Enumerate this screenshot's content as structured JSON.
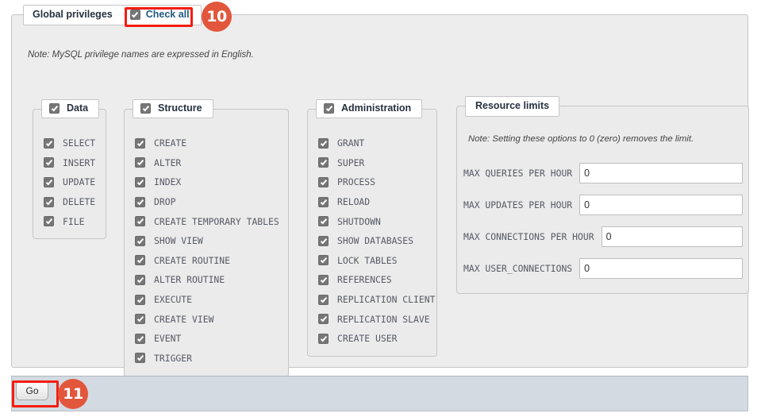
{
  "panel": {
    "legend_title": "Global privileges",
    "check_all_label": "Check all",
    "note": "Note: MySQL privilege names are expressed in English."
  },
  "annotations": [
    {
      "number": "10",
      "target": "check-all"
    },
    {
      "number": "11",
      "target": "go-button"
    }
  ],
  "groups": {
    "data": {
      "title": "Data",
      "privileges": [
        "SELECT",
        "INSERT",
        "UPDATE",
        "DELETE",
        "FILE"
      ]
    },
    "structure": {
      "title": "Structure",
      "privileges": [
        "CREATE",
        "ALTER",
        "INDEX",
        "DROP",
        "CREATE TEMPORARY TABLES",
        "SHOW VIEW",
        "CREATE ROUTINE",
        "ALTER ROUTINE",
        "EXECUTE",
        "CREATE VIEW",
        "EVENT",
        "TRIGGER"
      ]
    },
    "administration": {
      "title": "Administration",
      "privileges": [
        "GRANT",
        "SUPER",
        "PROCESS",
        "RELOAD",
        "SHUTDOWN",
        "SHOW DATABASES",
        "LOCK TABLES",
        "REFERENCES",
        "REPLICATION CLIENT",
        "REPLICATION SLAVE",
        "CREATE USER"
      ]
    }
  },
  "resource_limits": {
    "title": "Resource limits",
    "note": "Note: Setting these options to 0 (zero) removes the limit.",
    "fields": [
      {
        "label": "MAX QUERIES PER HOUR",
        "value": "0"
      },
      {
        "label": "MAX UPDATES PER HOUR",
        "value": "0"
      },
      {
        "label": "MAX CONNECTIONS PER HOUR",
        "value": "0"
      },
      {
        "label": "MAX USER_CONNECTIONS",
        "value": "0"
      }
    ]
  },
  "footer": {
    "go_label": "Go"
  },
  "colors": {
    "highlight": "#f51d10",
    "badge": "#e2573c",
    "link": "#235a81",
    "panel_bg": "#ededed",
    "footer_bg": "#d3dae2"
  }
}
